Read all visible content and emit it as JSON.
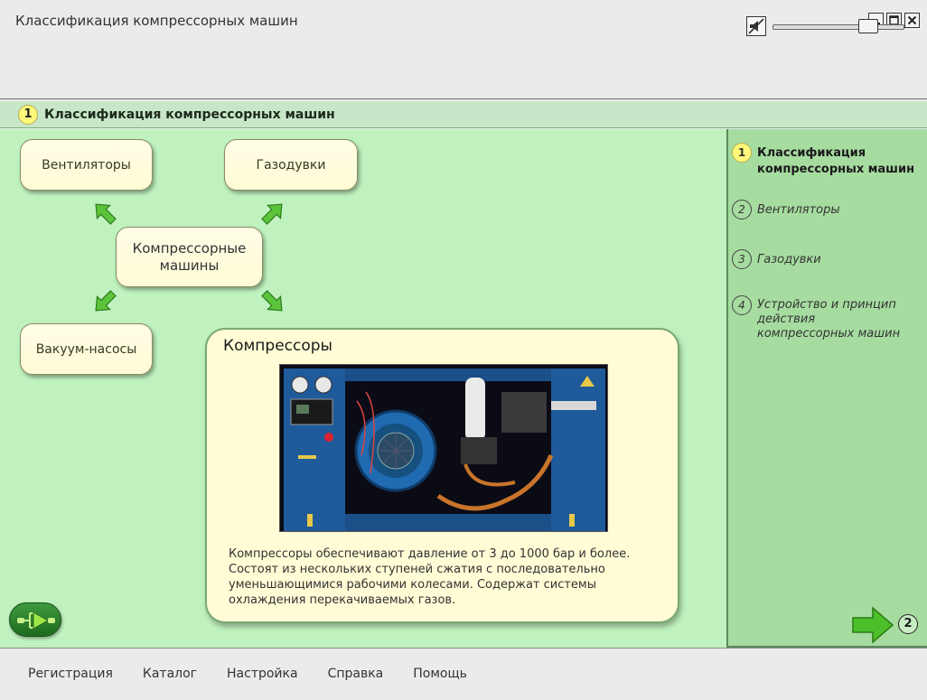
{
  "window": {
    "title": "Классификация компрессорных машин"
  },
  "section": {
    "number": "1",
    "title": "Классификация компрессорных машин"
  },
  "diagram": {
    "center": "Компрессорные машины",
    "fans": "Вентиляторы",
    "blowers": "Газодувки",
    "vacuum": "Вакуум-насосы"
  },
  "card": {
    "title": "Компрессоры",
    "text": "Компрессоры обеспечивают давление от 3 до 1000 бар и более. Состоят из нескольких ступеней сжатия с последовательно уменьшающимися рабочими колесами. Содержат системы охлаждения перекачиваемых газов."
  },
  "sidebar": {
    "items": [
      {
        "num": "1",
        "label": "Классификация компрессорных машин"
      },
      {
        "num": "2",
        "label": "Вентиляторы"
      },
      {
        "num": "3",
        "label": "Газодувки"
      },
      {
        "num": "4",
        "label": "Устройство и принцип действия компрессорных машин"
      }
    ],
    "next_num": "2"
  },
  "menu": {
    "items": [
      "Регистрация",
      "Каталог",
      "Настройка",
      "Справка",
      "Помощь"
    ]
  },
  "volume": {
    "level": 0.77
  },
  "colors": {
    "main_bg": "#bff2bf",
    "sidebar_bg": "#a6dca0",
    "badge": "#fff77a",
    "arrow": "#5cc43a"
  }
}
